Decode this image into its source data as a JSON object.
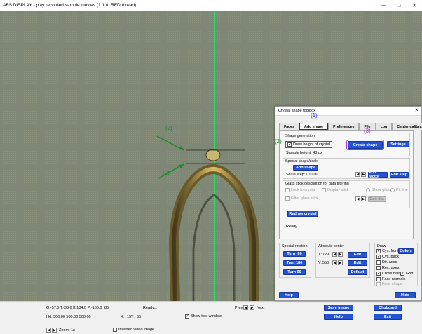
{
  "window": {
    "title": "ABS DISPLAY - play recorded sample movies (1.1.0; RED thread)",
    "controls": {
      "minimize": "—",
      "maximize": "□",
      "close": "✕"
    }
  },
  "annotations": {
    "label1": "(1)",
    "label2": "(2)",
    "label3": "(3)",
    "colors": {
      "blue": "#1d23d6",
      "green": "#1c8a2a",
      "purple": "#b531d6"
    }
  },
  "toolbox": {
    "title": "Crystal shape toolbox",
    "close": "✕",
    "tabs": [
      "Faces",
      "Add shape",
      "Preferences",
      "File",
      "Log",
      "Center calibration"
    ],
    "active_tab": "Add shape",
    "shape_generation": {
      "title": "Shape generation",
      "draw_height_label": "Draw height of crystal",
      "draw_height_checked": true,
      "create_shape": "Create shape",
      "settings": "Settings",
      "sample_height": "Sample height: 43 px"
    },
    "special_shape": {
      "title": "Special shape/scale",
      "add_shape": "Add shape",
      "scale_step": "Scale step: 0.0100",
      "edit_factor": "Edit factor",
      "edit_step": "Edit step"
    },
    "glass_stick": {
      "title": "Glass stick description for data filtering",
      "opt1": "Lock to crystal",
      "opt2": "Display stick",
      "opt3": "Show glass",
      "opt4": "Pt. line",
      "opt5": "Filter glass stick",
      "edit_btn": "Edit dia."
    },
    "redraw": "Redraw crystal",
    "status": "Ready...",
    "special_rotation": {
      "title": "Special rotation",
      "turn_m90": "Turn -90",
      "turn_180": "Turn 180",
      "turn_90": "Turn 90"
    },
    "absolute_center": {
      "title": "Absolute center",
      "x_label": "X:",
      "x_value": "729",
      "y_label": "Y:",
      "y_value": "550",
      "edit": "Edit",
      "default": "Default"
    },
    "draw": {
      "title": "Draw",
      "cyc_front": "Cys. front",
      "cyc_back": "Cys. back",
      "dir_axes": "Dir. axes",
      "rec_axes": "Rec. axes",
      "cross_hair": "Cross hair",
      "grid": "Grid",
      "face_normals": "Face normals",
      "face_shape": "Face shape",
      "colors": "Colors"
    },
    "help": "Help",
    "hide": "Hide"
  },
  "statusbar": {
    "coords": "O:-57.0 T:-30.0 K:134.0 P:-156.0",
    "frame": "85",
    "ready": "Ready...",
    "prev": "Prev",
    "next": "Next",
    "hkl": "hkl: 500.00 500.00 500.00",
    "x_label": "X:",
    "x_val": "15",
    "y_label": "Y:",
    "y_val": "65",
    "show_tool_window": "Show tool window",
    "zoom": "Zoom: 1x",
    "inverted": "Inverted video image",
    "save_image": "Save image",
    "clipboard": "Clipboard",
    "help": "Help",
    "exit": "Exit"
  }
}
